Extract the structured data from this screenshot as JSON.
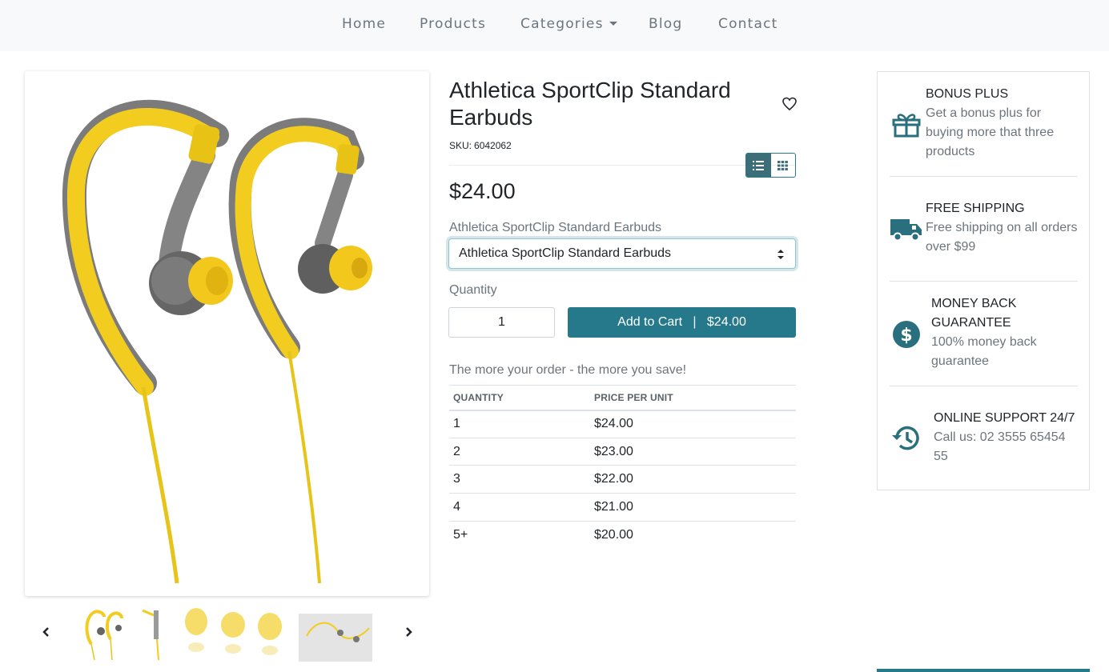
{
  "nav": {
    "items": [
      {
        "label": "Home"
      },
      {
        "label": "Products"
      },
      {
        "label": "Categories"
      },
      {
        "label": "Blog"
      },
      {
        "label": "Contact"
      }
    ]
  },
  "product": {
    "title": "Athletica SportClip Standard Earbuds",
    "sku_label": "SKU:",
    "sku": "6042062",
    "price": "$24.00",
    "variant_label": "Athletica SportClip Standard Earbuds",
    "variant_selected": "Athletica SportClip Standard Earbuds",
    "quantity_label": "Quantity",
    "quantity_value": "1",
    "add_to_cart": "Add to Cart   |   $24.00"
  },
  "tiers": {
    "intro": "The more your order - the more you save!",
    "headers": {
      "quantity": "QUANTITY",
      "price": "PRICE PER UNIT"
    },
    "rows": [
      {
        "qty": "1",
        "price": "$24.00"
      },
      {
        "qty": "2",
        "price": "$23.00"
      },
      {
        "qty": "3",
        "price": "$22.00"
      },
      {
        "qty": "4",
        "price": "$21.00"
      },
      {
        "qty": "5+",
        "price": "$20.00"
      }
    ]
  },
  "features": [
    {
      "title": "BONUS PLUS",
      "desc": "Get a bonus plus for buying more that three products",
      "icon": "gift-icon"
    },
    {
      "title": "FREE SHIPPING",
      "desc": "Free shipping on all orders over $99",
      "icon": "truck-icon"
    },
    {
      "title": "MONEY BACK GUARANTEE",
      "desc": "100% money back guarantee",
      "icon": "dollar-circle-icon"
    },
    {
      "title": "ONLINE SUPPORT 24/7",
      "desc": "Call us: 02 3555 65454 55",
      "icon": "history-clock-icon"
    }
  ],
  "colors": {
    "accent": "#26798a",
    "icon": "#2a6f7e",
    "earbud_yellow": "#f2cd1f",
    "earbud_grey": "#6e6e6e"
  }
}
